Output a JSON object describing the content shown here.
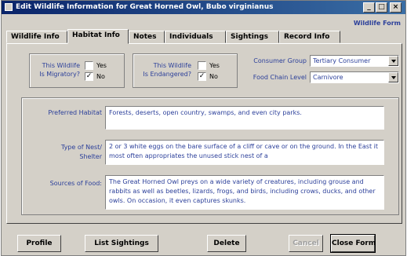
{
  "window": {
    "title": "Edit Wildlife Information for Great Horned Owl, Bubo virginianus",
    "caption": "Wildlife Form"
  },
  "tabs": [
    "Wildlife Info",
    "Habitat Info",
    "Notes",
    "Individuals",
    "Sightings",
    "Record Info"
  ],
  "active_tab": "Habitat Info",
  "migratory": {
    "label": "This Wildlife Is Migratory?",
    "label_line1": "This Wildlife",
    "label_line2": "Is Migratory?",
    "yes_label": "Yes",
    "no_label": "No",
    "value": "No"
  },
  "endangered": {
    "label": "This Wildlife Is Endangered?",
    "label_line1": "This Wildlife",
    "label_line2": "Is Endangered?",
    "yes_label": "Yes",
    "no_label": "No",
    "value": "No"
  },
  "consumer_group": {
    "label": "Consumer Group",
    "value": "Tertiary Consumer"
  },
  "food_chain_level": {
    "label": "Food Chain Level",
    "value": "Carnivore"
  },
  "preferred_habitat": {
    "label": "Preferred Habitat",
    "value": "Forests, deserts, open country, swamps, and even city parks."
  },
  "nest": {
    "label_line1": "Type of Nest/",
    "label_line2": "Shelter",
    "value": "2 or 3 white eggs on the bare surface of a cliff or cave or on the ground. In the East it most often appropriates the unused stick nest of a"
  },
  "food": {
    "label": "Sources of Food:",
    "value": "The Great Horned Owl preys on a wide variety of creatures, including grouse and rabbits as well as beetles, lizards, frogs, and birds, including crows, ducks, and other owls. On occasion, it even captures skunks."
  },
  "buttons": {
    "profile": "Profile",
    "list_sightings": "List Sightings",
    "delete": "Delete",
    "cancel": "Cancel",
    "close_form": "Close Form"
  }
}
